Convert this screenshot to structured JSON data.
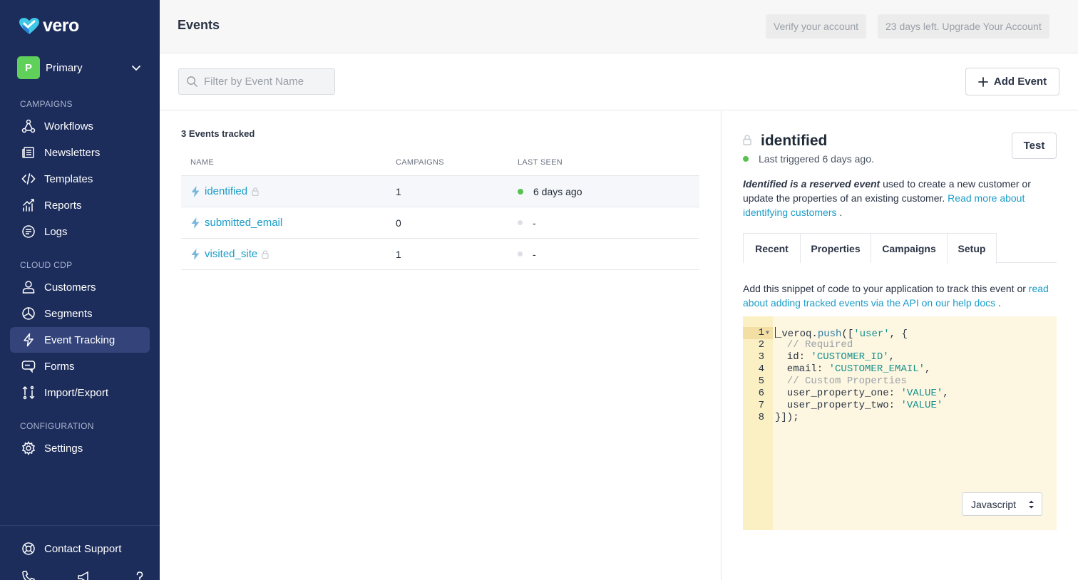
{
  "sidebar": {
    "logo": "vero",
    "workspace": {
      "initial": "P",
      "name": "Primary"
    },
    "sections": {
      "campaigns": "CAMPAIGNS",
      "cloud_cdp": "CLOUD CDP",
      "configuration": "CONFIGURATION"
    },
    "items": {
      "workflows": "Workflows",
      "newsletters": "Newsletters",
      "templates": "Templates",
      "reports": "Reports",
      "logs": "Logs",
      "customers": "Customers",
      "segments": "Segments",
      "event_tracking": "Event Tracking",
      "forms": "Forms",
      "import_export": "Import/Export",
      "settings": "Settings",
      "contact_support": "Contact Support"
    },
    "active_item": "Event Tracking"
  },
  "header": {
    "title": "Events",
    "verify_label": "Verify your account",
    "upgrade_label": "23 days left. Upgrade Your Account"
  },
  "toolbar": {
    "filter_placeholder": "Filter by Event Name",
    "add_event_label": "Add Event"
  },
  "events": {
    "count_label": "3 Events tracked",
    "columns": {
      "name": "NAME",
      "campaigns": "CAMPAIGNS",
      "last_seen": "LAST SEEN"
    },
    "rows": [
      {
        "name": "identified",
        "campaigns": "1",
        "last_seen": "6 days ago",
        "locked": true,
        "status": "active"
      },
      {
        "name": "submitted_email",
        "campaigns": "0",
        "last_seen": "-",
        "locked": false,
        "status": "inactive"
      },
      {
        "name": "visited_site",
        "campaigns": "1",
        "last_seen": "-",
        "locked": true,
        "status": "inactive"
      }
    ]
  },
  "detail": {
    "title": "identified",
    "status": "Last triggered 6 days ago.",
    "test_label": "Test",
    "desc_em": "Identified is a reserved event",
    "desc_text": " used to create a new customer or update the properties of an existing customer. ",
    "desc_link": "Read more about identifying customers",
    "desc_end": " .",
    "tabs": [
      "Recent",
      "Properties",
      "Campaigns",
      "Setup"
    ],
    "active_tab": "Setup",
    "snippet_text": "Add this snippet of code to your application to track this event or ",
    "snippet_link": "read about adding tracked events via the API on our help docs",
    "snippet_end": " .",
    "code": {
      "line_numbers": [
        "1",
        "2",
        "3",
        "4",
        "5",
        "6",
        "7",
        "8"
      ],
      "l1_a": "_veroq.",
      "l1_fn": "push",
      "l1_b": "([",
      "l1_str": "'user'",
      "l1_c": ", {",
      "l2": "  // Required",
      "l3_key": "  id: ",
      "l3_str": "'CUSTOMER_ID'",
      "l3_end": ",",
      "l4_key": "  email: ",
      "l4_str": "'CUSTOMER_EMAIL'",
      "l4_end": ",",
      "l5": "  // Custom Properties",
      "l6_key": "  user_property_one: ",
      "l6_str": "'VALUE'",
      "l6_end": ",",
      "l7_key": "  user_property_two: ",
      "l7_str": "'VALUE'",
      "l8": "}]);"
    },
    "language": "Javascript"
  },
  "colors": {
    "sidebar_bg": "#1c2c5b",
    "accent_link": "#1a9cc8",
    "status_green": "#56c24f",
    "code_bg": "#fdf7e1"
  }
}
